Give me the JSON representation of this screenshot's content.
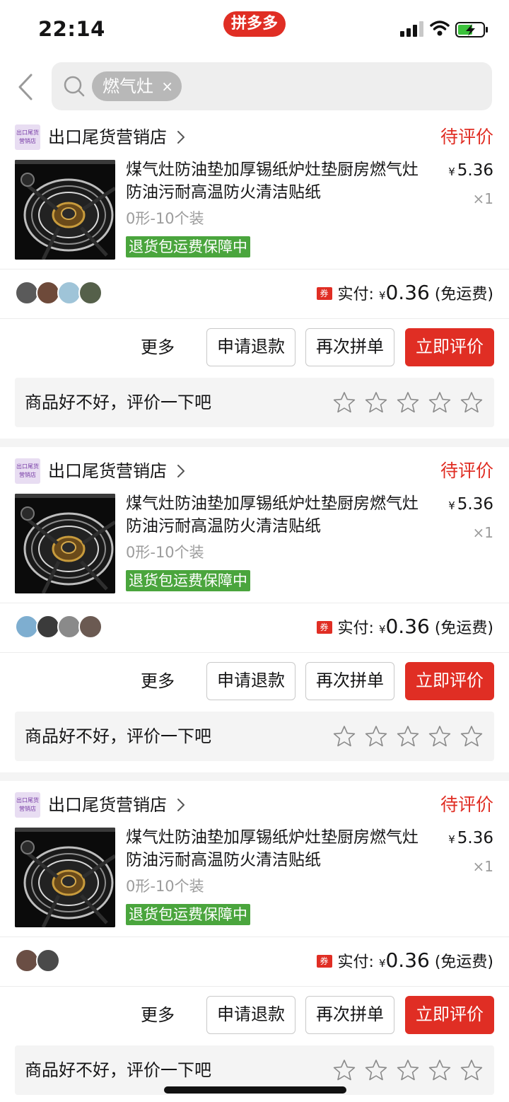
{
  "status_bar": {
    "time": "22:14",
    "brand": "拼多多"
  },
  "search": {
    "chip": "燃气灶",
    "chip_close": "×"
  },
  "orders": [
    {
      "shop_name": "出口尾货营销店",
      "shop_logo_text": "出口尾货营销店",
      "status": "待评价",
      "title": "煤气灶防油垫加厚锡纸炉灶垫厨房燃气灶防油污耐高温防火清洁贴纸",
      "spec": "0形-10个装",
      "guarantee": "退货包运费保障中",
      "price_symbol": "¥",
      "price": "5.36",
      "quantity": "×1",
      "coupon": "券",
      "paid_label": "实付:",
      "paid_symbol": "¥",
      "paid_amount": "0.36",
      "shipping": "(免运费)",
      "buttons": {
        "more": "更多",
        "refund": "申请退款",
        "regroup": "再次拼单",
        "review": "立即评价"
      },
      "rate_prompt": "商品好不好，评价一下吧",
      "avatar_colors": [
        "#5a5a5a",
        "#6e4a3a",
        "#9fc4d8",
        "#55604a"
      ]
    },
    {
      "shop_name": "出口尾货营销店",
      "shop_logo_text": "出口尾货营销店",
      "status": "待评价",
      "title": "煤气灶防油垫加厚锡纸炉灶垫厨房燃气灶防油污耐高温防火清洁贴纸",
      "spec": "0形-10个装",
      "guarantee": "退货包运费保障中",
      "price_symbol": "¥",
      "price": "5.36",
      "quantity": "×1",
      "coupon": "券",
      "paid_label": "实付:",
      "paid_symbol": "¥",
      "paid_amount": "0.36",
      "shipping": "(免运费)",
      "buttons": {
        "more": "更多",
        "refund": "申请退款",
        "regroup": "再次拼单",
        "review": "立即评价"
      },
      "rate_prompt": "商品好不好，评价一下吧",
      "avatar_colors": [
        "#7eaed0",
        "#3b3b3b",
        "#8a8a8a",
        "#6b5a52"
      ]
    },
    {
      "shop_name": "出口尾货营销店",
      "shop_logo_text": "出口尾货营销店",
      "status": "待评价",
      "title": "煤气灶防油垫加厚锡纸炉灶垫厨房燃气灶防油污耐高温防火清洁贴纸",
      "spec": "0形-10个装",
      "guarantee": "退货包运费保障中",
      "price_symbol": "¥",
      "price": "5.36",
      "quantity": "×1",
      "coupon": "券",
      "paid_label": "实付:",
      "paid_symbol": "¥",
      "paid_amount": "0.36",
      "shipping": "(免运费)",
      "buttons": {
        "more": "更多",
        "refund": "申请退款",
        "regroup": "再次拼单",
        "review": "立即评价"
      },
      "rate_prompt": "商品好不好，评价一下吧",
      "avatar_colors": [
        "#6a4e44",
        "#4a4a4a"
      ]
    }
  ],
  "colors": {
    "brand": "#e02e24",
    "guarantee": "#4aa53d",
    "muted": "#9c9c9c"
  }
}
